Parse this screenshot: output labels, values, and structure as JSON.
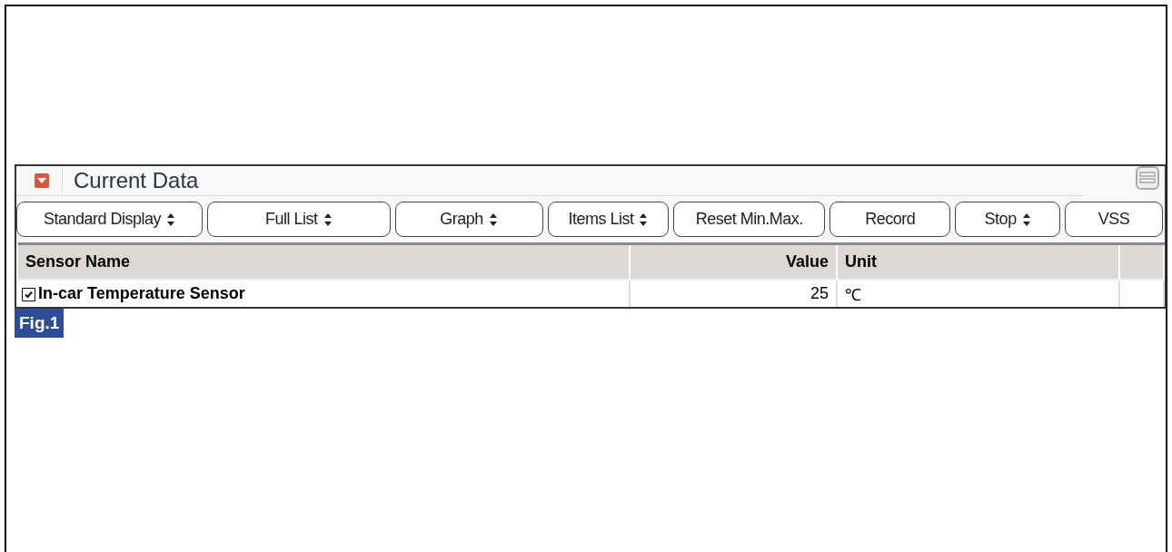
{
  "panel": {
    "title": "Current Data",
    "expanded": true
  },
  "toolbar": [
    {
      "label": "Standard Display",
      "kind": "dropdown"
    },
    {
      "label": "Full List",
      "kind": "dropdown"
    },
    {
      "label": "Graph",
      "kind": "dropdown"
    },
    {
      "label": "Items List",
      "kind": "dropdown"
    },
    {
      "label": "Reset Min.Max.",
      "kind": "button"
    },
    {
      "label": "Record",
      "kind": "button"
    },
    {
      "label": "Stop",
      "kind": "dropdown"
    },
    {
      "label": "VSS",
      "kind": "button"
    }
  ],
  "table": {
    "columns": [
      "Sensor Name",
      "Value",
      "Unit"
    ],
    "rows": [
      {
        "checked": true,
        "cells": [
          "In-car Temperature Sensor",
          "25",
          "℃"
        ]
      }
    ]
  },
  "figure_label": "Fig.1"
}
